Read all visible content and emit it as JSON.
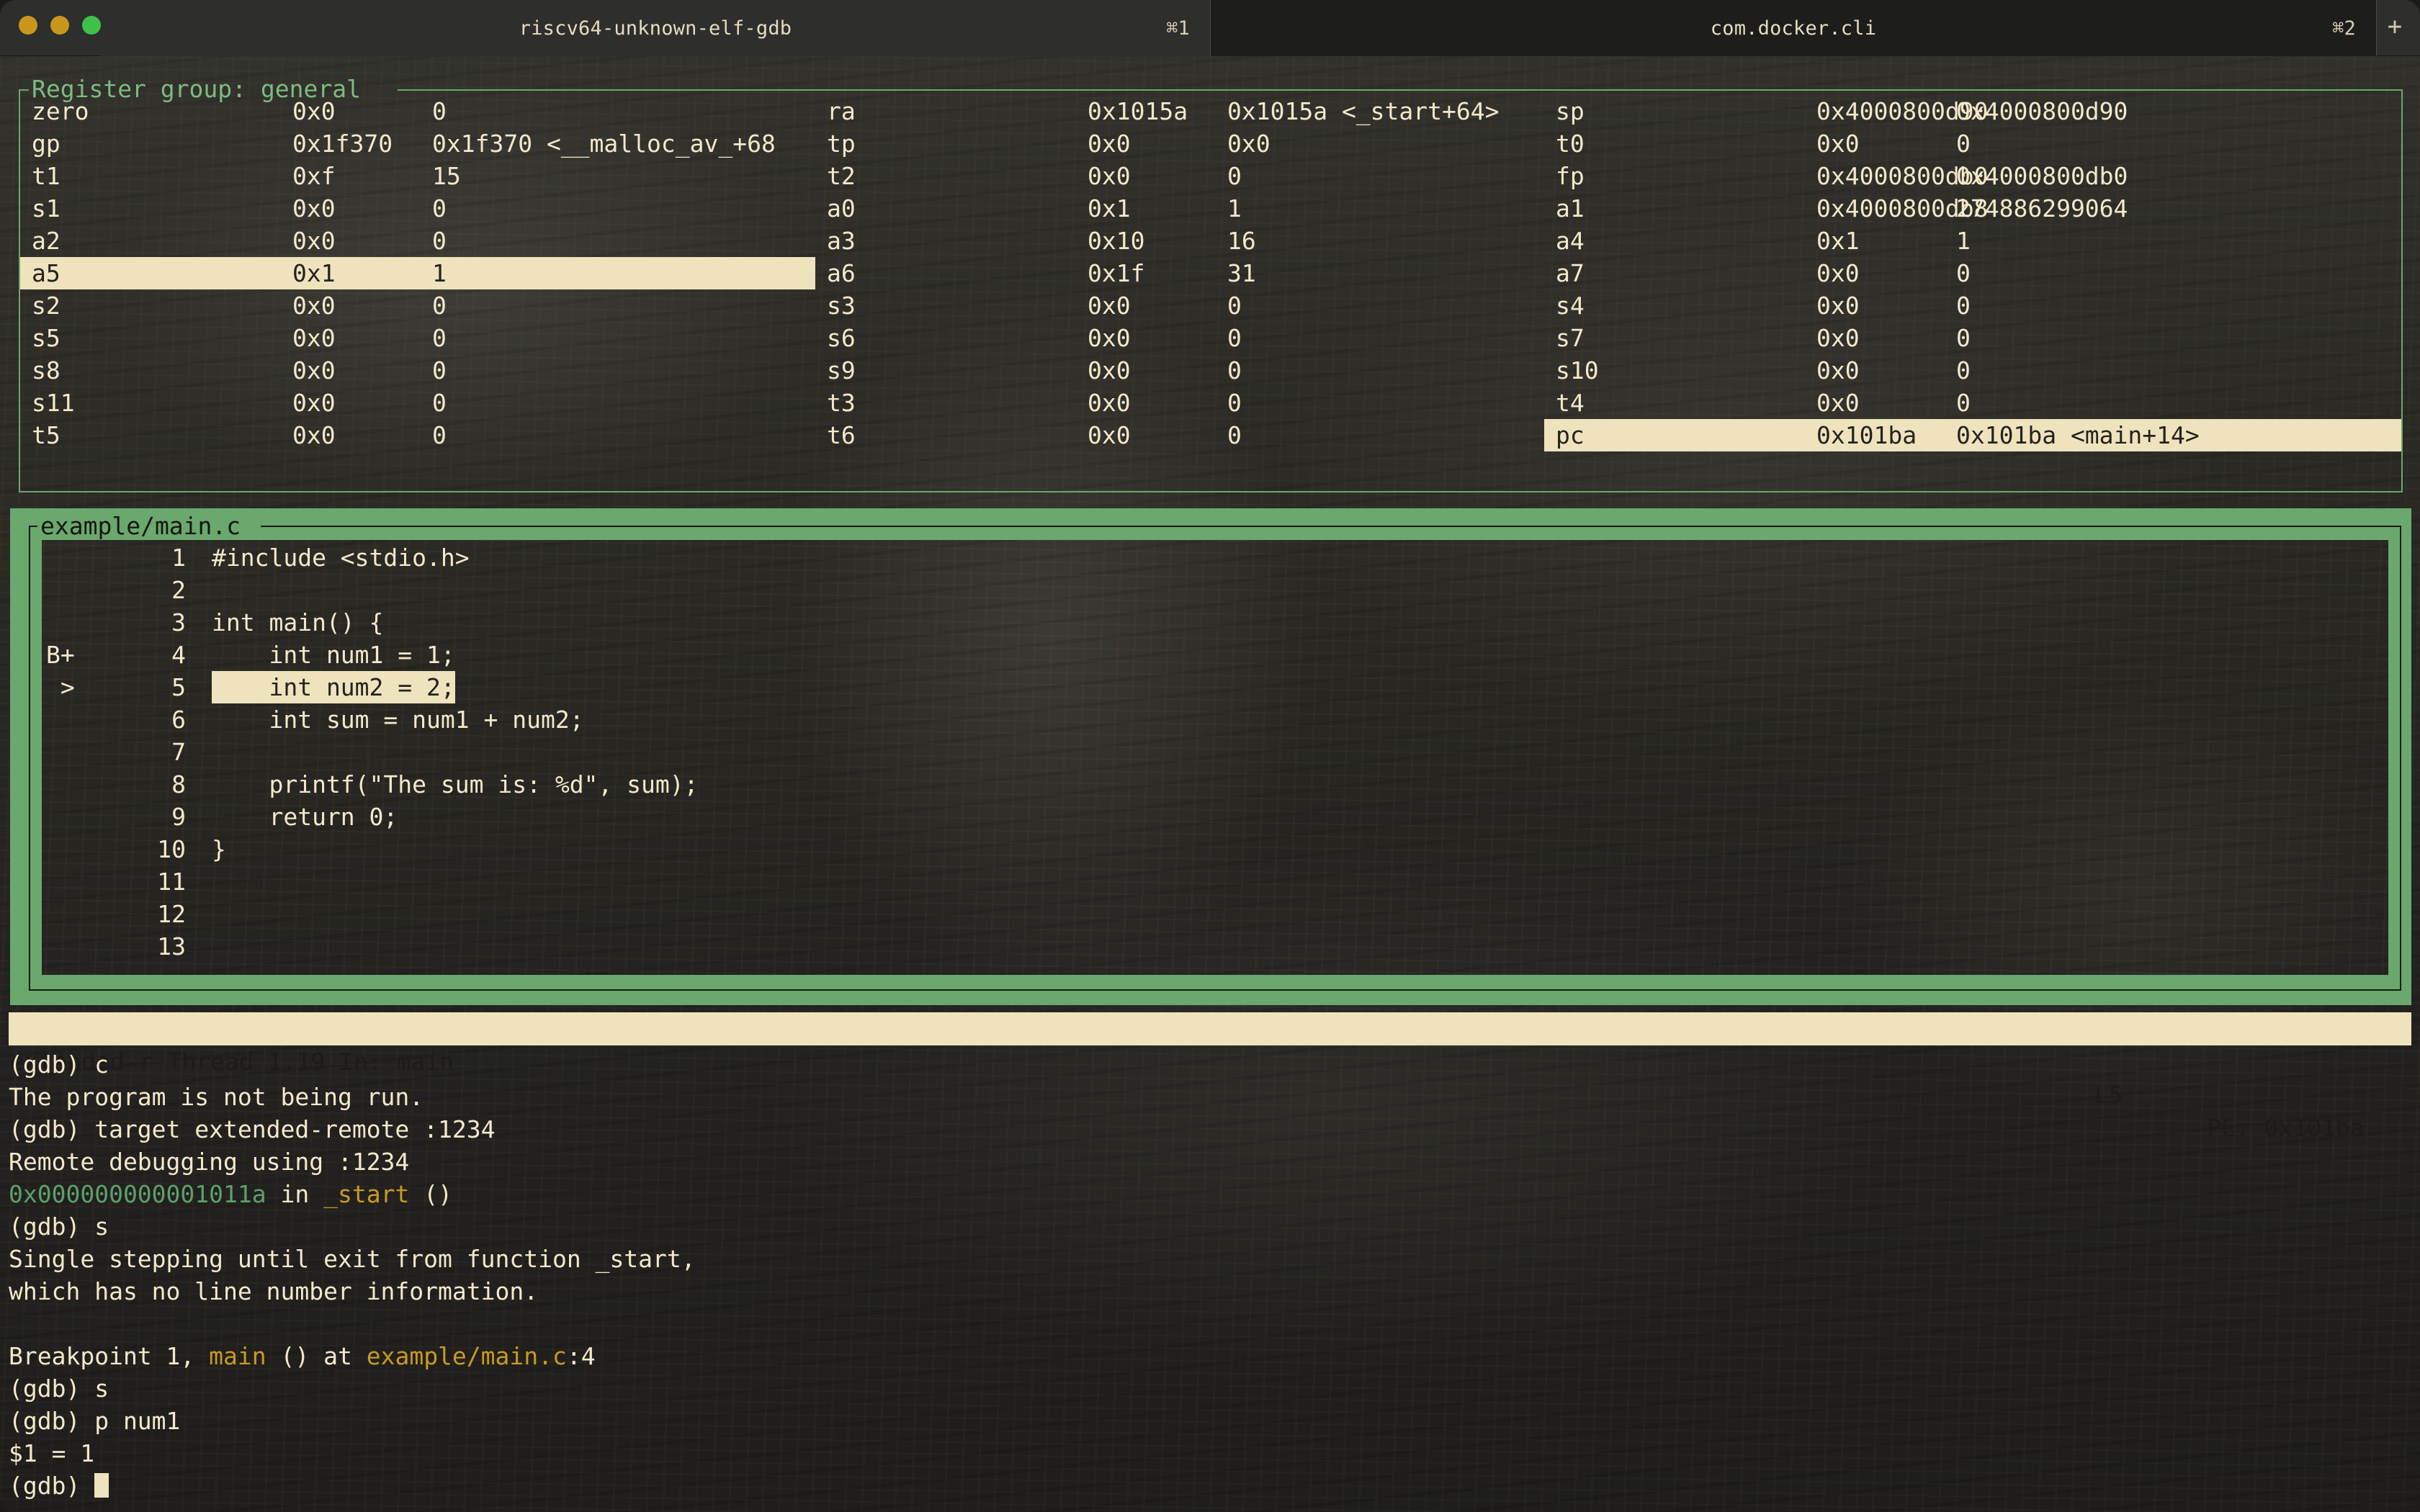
{
  "window": {
    "traffic_lights": [
      "close",
      "minimize",
      "maximize"
    ],
    "new_tab_glyph": "+"
  },
  "tabs": [
    {
      "title": "riscv64-unknown-elf-gdb",
      "shortcut": "⌘1",
      "active": true
    },
    {
      "title": "com.docker.cli",
      "shortcut": "⌘2",
      "active": false
    }
  ],
  "registers": {
    "title": "Register group: general",
    "columns": [
      "name",
      "hex",
      "dec"
    ],
    "col1": [
      {
        "name": "zero",
        "hex": "0x0",
        "dec": "0",
        "highlight": false
      },
      {
        "name": "gp",
        "hex": "0x1f370",
        "dec": "0x1f370 <__malloc_av_+68",
        "highlight": false
      },
      {
        "name": "t1",
        "hex": "0xf",
        "dec": "15",
        "highlight": false
      },
      {
        "name": "s1",
        "hex": "0x0",
        "dec": "0",
        "highlight": false
      },
      {
        "name": "a2",
        "hex": "0x0",
        "dec": "0",
        "highlight": false
      },
      {
        "name": "a5",
        "hex": "0x1",
        "dec": "1",
        "highlight": true
      },
      {
        "name": "s2",
        "hex": "0x0",
        "dec": "0",
        "highlight": false
      },
      {
        "name": "s5",
        "hex": "0x0",
        "dec": "0",
        "highlight": false
      },
      {
        "name": "s8",
        "hex": "0x0",
        "dec": "0",
        "highlight": false
      },
      {
        "name": "s11",
        "hex": "0x0",
        "dec": "0",
        "highlight": false
      },
      {
        "name": "t5",
        "hex": "0x0",
        "dec": "0",
        "highlight": false
      }
    ],
    "col2": [
      {
        "name": "ra",
        "hex": "0x1015a",
        "dec": "0x1015a <_start+64>",
        "highlight": false
      },
      {
        "name": "tp",
        "hex": "0x0",
        "dec": "0x0",
        "highlight": false
      },
      {
        "name": "t2",
        "hex": "0x0",
        "dec": "0",
        "highlight": false
      },
      {
        "name": "a0",
        "hex": "0x1",
        "dec": "1",
        "highlight": false
      },
      {
        "name": "a3",
        "hex": "0x10",
        "dec": "16",
        "highlight": false
      },
      {
        "name": "a6",
        "hex": "0x1f",
        "dec": "31",
        "highlight": false
      },
      {
        "name": "s3",
        "hex": "0x0",
        "dec": "0",
        "highlight": false
      },
      {
        "name": "s6",
        "hex": "0x0",
        "dec": "0",
        "highlight": false
      },
      {
        "name": "s9",
        "hex": "0x0",
        "dec": "0",
        "highlight": false
      },
      {
        "name": "t3",
        "hex": "0x0",
        "dec": "0",
        "highlight": false
      },
      {
        "name": "t6",
        "hex": "0x0",
        "dec": "0",
        "highlight": false
      }
    ],
    "col3": [
      {
        "name": "sp",
        "hex": "0x4000800d90",
        "dec": "0x4000800d90",
        "highlight": false
      },
      {
        "name": "t0",
        "hex": "0x0",
        "dec": "0",
        "highlight": false
      },
      {
        "name": "fp",
        "hex": "0x4000800db0",
        "dec": "0x4000800db0",
        "highlight": false
      },
      {
        "name": "a1",
        "hex": "0x4000800db8",
        "dec": "274886299064",
        "highlight": false
      },
      {
        "name": "a4",
        "hex": "0x1",
        "dec": "1",
        "highlight": false
      },
      {
        "name": "a7",
        "hex": "0x0",
        "dec": "0",
        "highlight": false
      },
      {
        "name": "s4",
        "hex": "0x0",
        "dec": "0",
        "highlight": false
      },
      {
        "name": "s7",
        "hex": "0x0",
        "dec": "0",
        "highlight": false
      },
      {
        "name": "s10",
        "hex": "0x0",
        "dec": "0",
        "highlight": false
      },
      {
        "name": "t4",
        "hex": "0x0",
        "dec": "0",
        "highlight": false
      },
      {
        "name": "pc",
        "hex": "0x101ba",
        "dec": "0x101ba <main+14>",
        "highlight": true
      }
    ]
  },
  "source": {
    "title": "example/main.c",
    "lines": [
      {
        "mark": "",
        "num": "1",
        "text": "#include <stdio.h>",
        "highlight": false
      },
      {
        "mark": "",
        "num": "2",
        "text": "",
        "highlight": false
      },
      {
        "mark": "",
        "num": "3",
        "text": "int main() {",
        "highlight": false
      },
      {
        "mark": "B+",
        "num": "4",
        "text": "    int num1 = 1;",
        "highlight": false
      },
      {
        "mark": " >",
        "num": "5",
        "text": "    int num2 = 2;",
        "highlight": true
      },
      {
        "mark": "",
        "num": "6",
        "text": "    int sum = num1 + num2;",
        "highlight": false
      },
      {
        "mark": "",
        "num": "7",
        "text": "",
        "highlight": false
      },
      {
        "mark": "",
        "num": "8",
        "text": "    printf(\"The sum is: %d\", sum);",
        "highlight": false
      },
      {
        "mark": "",
        "num": "9",
        "text": "    return 0;",
        "highlight": false
      },
      {
        "mark": "",
        "num": "10",
        "text": "}",
        "highlight": false
      },
      {
        "mark": "",
        "num": "11",
        "text": "",
        "highlight": false
      },
      {
        "mark": "",
        "num": "12",
        "text": "",
        "highlight": false
      },
      {
        "mark": "",
        "num": "13",
        "text": "",
        "highlight": false
      }
    ]
  },
  "status_bar": {
    "left": "extended-r Thread 1.19 In: main",
    "line": "L5",
    "pc": "PC: 0x101ba"
  },
  "console": {
    "lines": [
      {
        "segments": [
          {
            "t": "(gdb) c",
            "c": "plain"
          }
        ]
      },
      {
        "segments": [
          {
            "t": "The program is not being run.",
            "c": "plain"
          }
        ]
      },
      {
        "segments": [
          {
            "t": "(gdb) target extended-remote :1234",
            "c": "plain"
          }
        ]
      },
      {
        "segments": [
          {
            "t": "Remote debugging using :1234",
            "c": "plain"
          }
        ]
      },
      {
        "segments": [
          {
            "t": "0x000000000001011a",
            "c": "addr"
          },
          {
            "t": " in ",
            "c": "plain"
          },
          {
            "t": "_start",
            "c": "sym"
          },
          {
            "t": " ()",
            "c": "plain"
          }
        ]
      },
      {
        "segments": [
          {
            "t": "(gdb) s",
            "c": "plain"
          }
        ]
      },
      {
        "segments": [
          {
            "t": "Single stepping until exit from function _start,",
            "c": "plain"
          }
        ]
      },
      {
        "segments": [
          {
            "t": "which has no line number information.",
            "c": "plain"
          }
        ]
      },
      {
        "segments": [
          {
            "t": "",
            "c": "plain"
          }
        ]
      },
      {
        "segments": [
          {
            "t": "Breakpoint 1, ",
            "c": "plain"
          },
          {
            "t": "main",
            "c": "sym"
          },
          {
            "t": " () at ",
            "c": "plain"
          },
          {
            "t": "example/main.c",
            "c": "sym"
          },
          {
            "t": ":4",
            "c": "plain"
          }
        ]
      },
      {
        "segments": [
          {
            "t": "(gdb) s",
            "c": "plain"
          }
        ]
      },
      {
        "segments": [
          {
            "t": "(gdb) p num1",
            "c": "plain"
          }
        ]
      },
      {
        "segments": [
          {
            "t": "$1 = 1",
            "c": "plain"
          }
        ]
      },
      {
        "segments": [
          {
            "t": "(gdb) ",
            "c": "plain"
          },
          {
            "t": "",
            "c": "cursor"
          }
        ]
      }
    ]
  },
  "colors": {
    "frame_green": "#6aa86d",
    "title_green": "#7cbb80",
    "highlight_bg": "#efe3bd",
    "text_cream": "#f3e8cb",
    "addr_green": "#5da06a",
    "symbol_gold": "#c99a22",
    "terminal_bg": "#262521"
  }
}
